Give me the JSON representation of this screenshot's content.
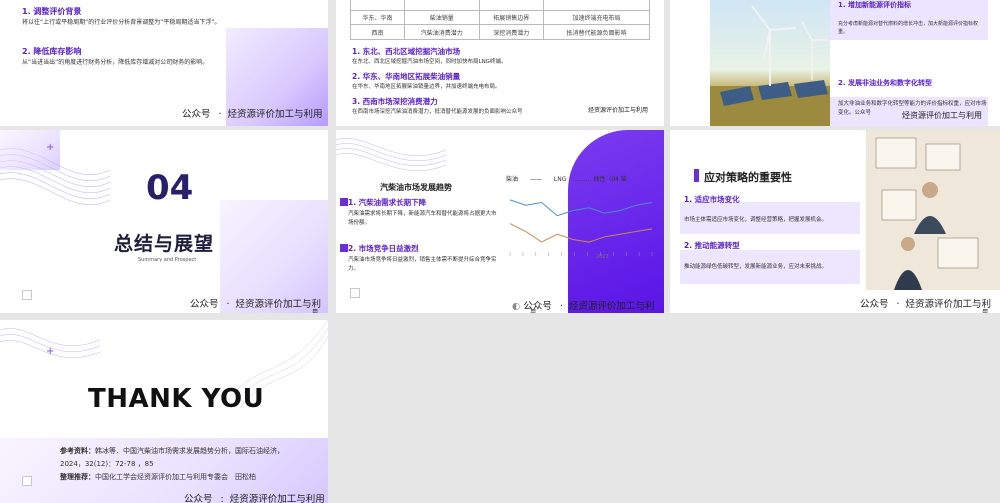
{
  "footer": {
    "brand": "公众号",
    "name": "烃资源评价加工与利用",
    "name_wrap": "烃资源评价加工与利用",
    "cut_a": "烃资源评价加工与利",
    "cut_b": "用",
    "cut_c": "烃资源评价加工与利",
    "cut_d": "用"
  },
  "slide1": {
    "h1": "1. 调整评价背景",
    "p1": "将以往“上行或平稳周期”的行业评价分析背景调整为“平稳周期适当下浮”。",
    "h2": "2. 降低库存影响",
    "p2": "从“当进当出”的角度进行财务分析，降低库存增减对公司财务的影响。"
  },
  "slide2": {
    "rows": [
      [
        "",
        "",
        "",
        ""
      ],
      [
        "华东、华南",
        "柴油销量",
        "拓展销售边界",
        "加速终端充电布局"
      ],
      [
        "西南",
        "汽柴油消费潜力",
        "深挖消费潜力",
        "抵消替代能源负面影响"
      ]
    ],
    "items": [
      {
        "h": "1. 东北、西北区域挖掘汽油市场",
        "p": "在东北、西北区域挖掘汽油市场空间，同时加快布局LNG终端。"
      },
      {
        "h": "2. 华东、华南地区拓展柴油销量",
        "p": "在华东、华南地区拓展柴油销量边界，并加速终端充电布局。"
      },
      {
        "h": "3. 西南市场深挖消费潜力",
        "p": "在西南市场深挖汽柴油消费潜力，抵消替代能源发展的负面影响公众号"
      }
    ],
    "footer_right": "烃资源评价加工与利用"
  },
  "slide3": {
    "h1": "1. 增加新能源评价指标",
    "p1": "充分考虑新能源对替代燃料的增长冲击，加大新能源评价指标权重。",
    "h2": "2. 发展非油业务和数字化转型",
    "p2": "加大非油业务和数字化转型等能力的评价指标权重，应对市场变化。公众号",
    "footer_tail": "烃资源评价加工与利用"
  },
  "slide4": {
    "num": "04",
    "title": "总结与展望",
    "sub": "Summary and Prospect"
  },
  "slide5": {
    "title": "汽柴油市场发展趋势",
    "h1": "1. 汽柴油需求长期下降",
    "p1": "汽柴油需求将长期下降，新能源汽车和替代能源将占据更大市场份额。",
    "h2": "2. 市场竞争日益激烈",
    "p2": "汽柴油市场竞争将日益激烈，销售主体需不断提升综合竞争实力。",
    "chart_legend": [
      "柴油",
      "LNG",
      "线性（04 柴"
    ],
    "year": "2023"
  },
  "slide6": {
    "title": "应对策略的重要性",
    "h1": "1. 适应市场变化",
    "p1": "市场主体需适应市场变化，调整经营策略，把握发展机会。",
    "h2": "2. 推动能源转型",
    "p2": "推动能源绿色低碳转型，发展新能源业务，应对未来挑战。"
  },
  "slide7": {
    "thank": "THANK YOU",
    "ref_label": "参考资料：",
    "ref_text": "韩冰等．中国汽柴油市场需求发展趋势分析，国际石油经济，2024，32(12)：72-78 ，85",
    "org_label": "整理推荐：",
    "org_text": "中国化工学会烃资源评价加工与利用专委会　田松柏"
  },
  "chart_data": {
    "type": "line",
    "series": [
      {
        "name": "柴油",
        "values": [
          6.2,
          6.0,
          6.1,
          5.6,
          5.8,
          5.9,
          5.7,
          5.8,
          6.0,
          6.1
        ]
      },
      {
        "name": "LNG",
        "values": [
          5.3,
          5.0,
          4.6,
          4.9,
          4.7,
          4.6,
          4.8,
          4.9,
          5.0,
          5.1
        ]
      }
    ],
    "colors": {
      "柴油": "#4a8fc8",
      "LNG": "#c98a4a"
    }
  }
}
